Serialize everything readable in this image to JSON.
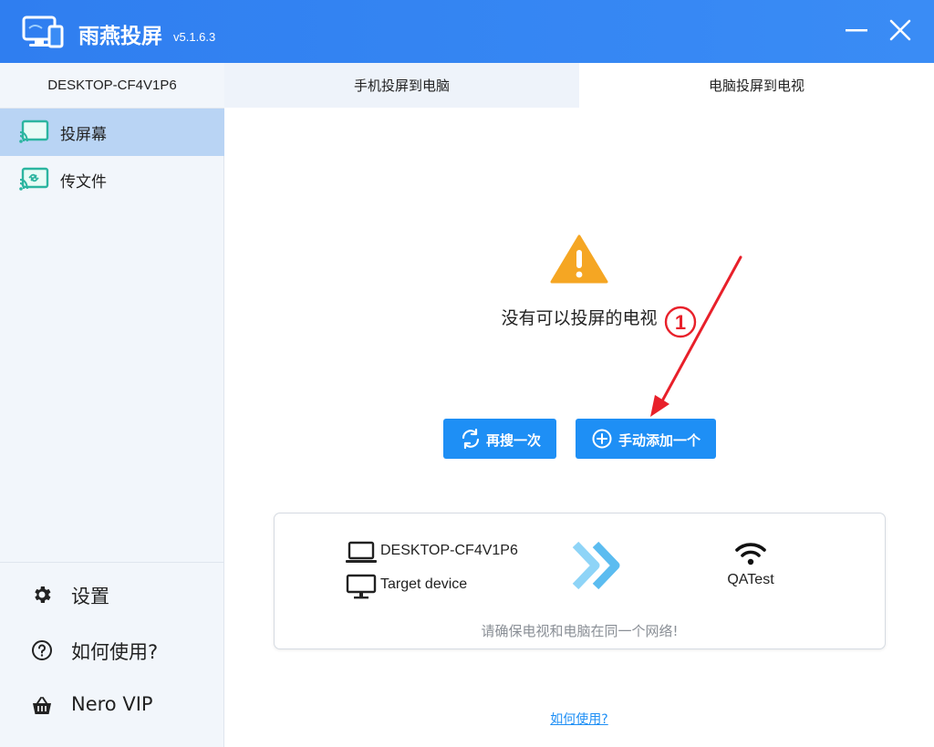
{
  "app": {
    "title": "雨燕投屏",
    "version": "v5.1.6.3"
  },
  "window_controls": {
    "minimize_icon": "minimize-icon",
    "close_icon": "close-icon"
  },
  "sidebar": {
    "device_name": "DESKTOP-CF4V1P6",
    "items": [
      {
        "label": "投屏幕",
        "icon": "cast-screen-icon",
        "active": true
      },
      {
        "label": "传文件",
        "icon": "cast-file-icon",
        "active": false
      }
    ],
    "bottom_items": [
      {
        "label": "设置",
        "icon": "gear-icon"
      },
      {
        "label": "如何使用?",
        "icon": "question-icon"
      },
      {
        "label": "Nero VIP",
        "icon": "basket-icon"
      }
    ]
  },
  "tabs": [
    {
      "label": "手机投屏到电脑",
      "active": false
    },
    {
      "label": "电脑投屏到电视",
      "active": true
    }
  ],
  "main": {
    "empty_message": "没有可以投屏的电视",
    "annotation_number": "①",
    "buttons": {
      "search_again": "再搜一次",
      "add_manually": "手动添加一个"
    },
    "card": {
      "local_device": "DESKTOP-CF4V1P6",
      "target_label": "Target device",
      "network_name": "QATest",
      "hint": "请确保电视和电脑在同一个网络!"
    },
    "help_link": "如何使用?"
  },
  "colors": {
    "titlebar": "#2f7ef0",
    "accent": "#1e8ff5",
    "sidebar_bg": "#f2f6fb",
    "sidebar_active": "#b9d4f4",
    "warning": "#f5a623",
    "annotation": "#e8202a"
  }
}
